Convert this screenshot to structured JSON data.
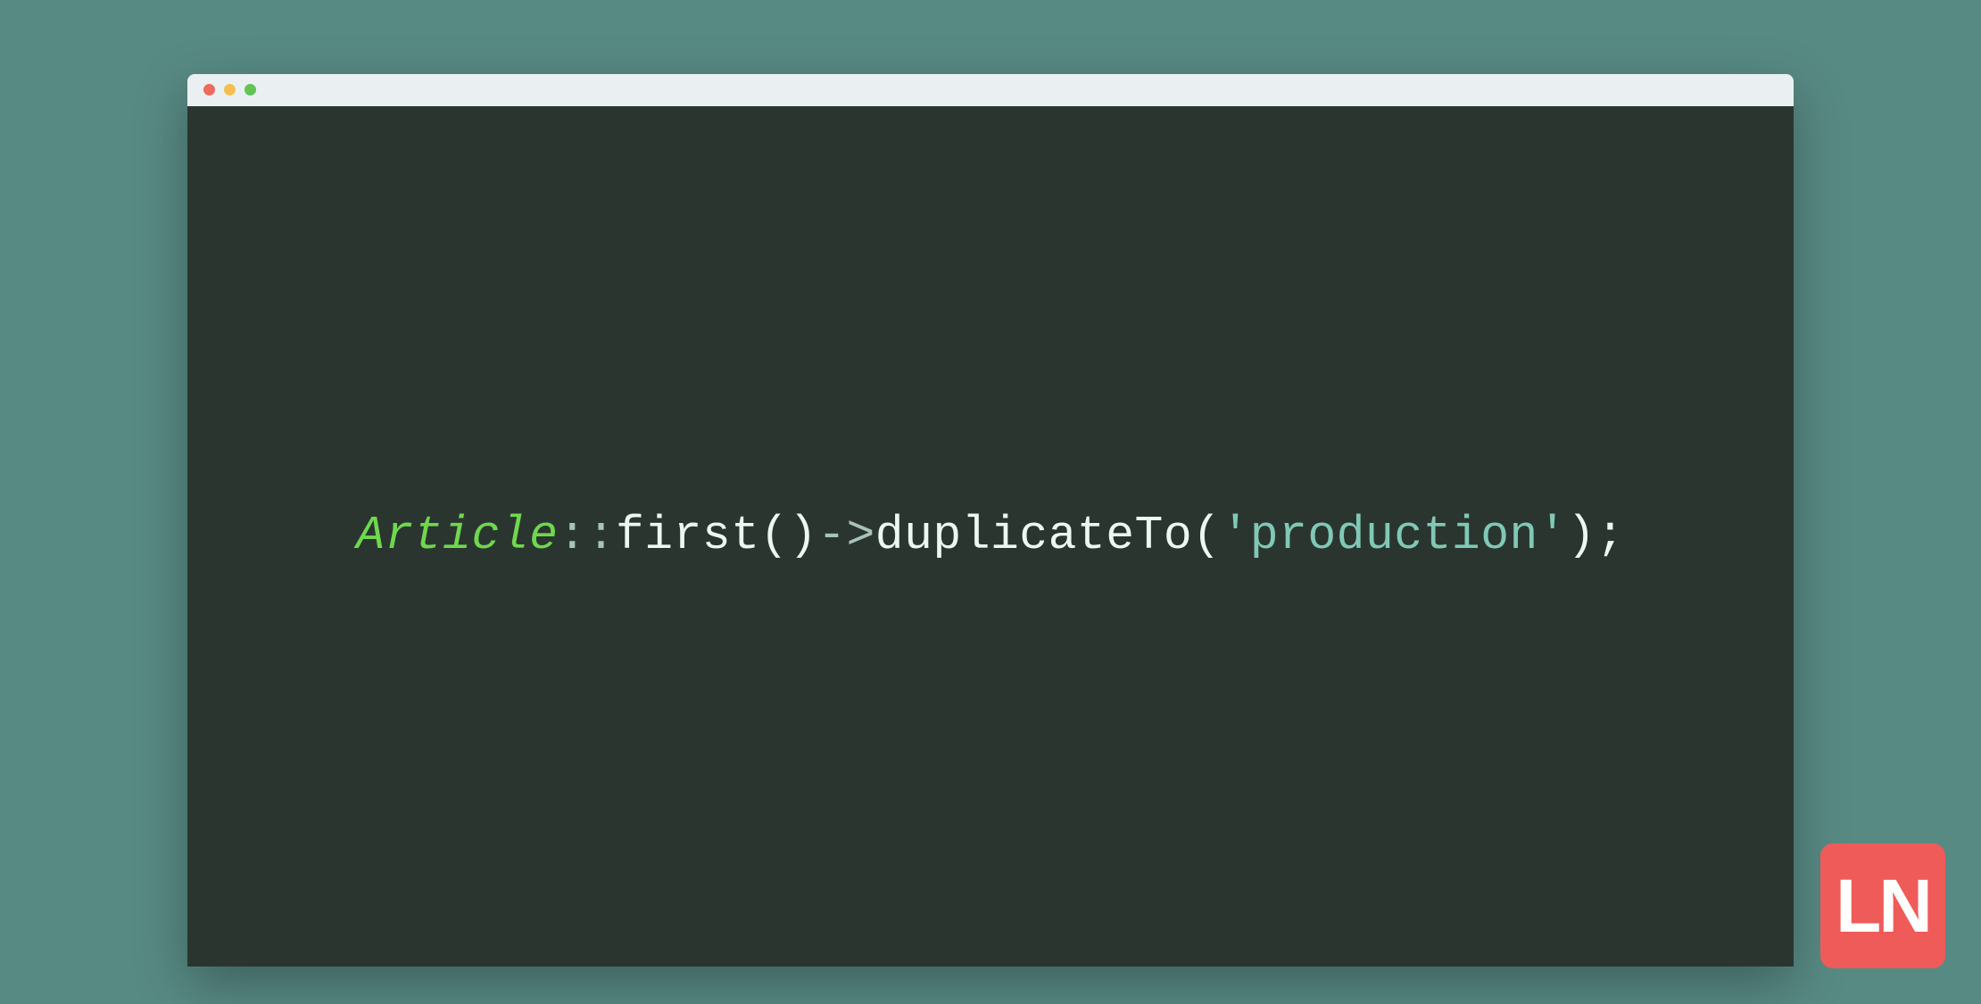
{
  "colors": {
    "background": "#588a84",
    "editor_bg": "#2b3530",
    "titlebar_bg": "#eaf0f1",
    "traffic_red": "#ec6a5e",
    "traffic_yellow": "#f5bf4f",
    "traffic_green": "#61c454",
    "token_class": "#6fd84e",
    "token_operator": "#a7c3bb",
    "token_method": "#edf6f2",
    "token_string": "#7fc9b6",
    "logo_bg": "#ef5b58",
    "logo_fg": "#ffffff"
  },
  "code": {
    "tokens": {
      "class_name": "Article",
      "scope_op": "::",
      "method1": "first",
      "paren_pair1": "()",
      "arrow_op": "->",
      "method2": "duplicateTo",
      "open_paren": "(",
      "string_arg": "'production'",
      "close_paren": ")",
      "semicolon": ";"
    },
    "full_line": "Article::first()->duplicateTo('production');"
  },
  "logo": {
    "text": "LN"
  }
}
